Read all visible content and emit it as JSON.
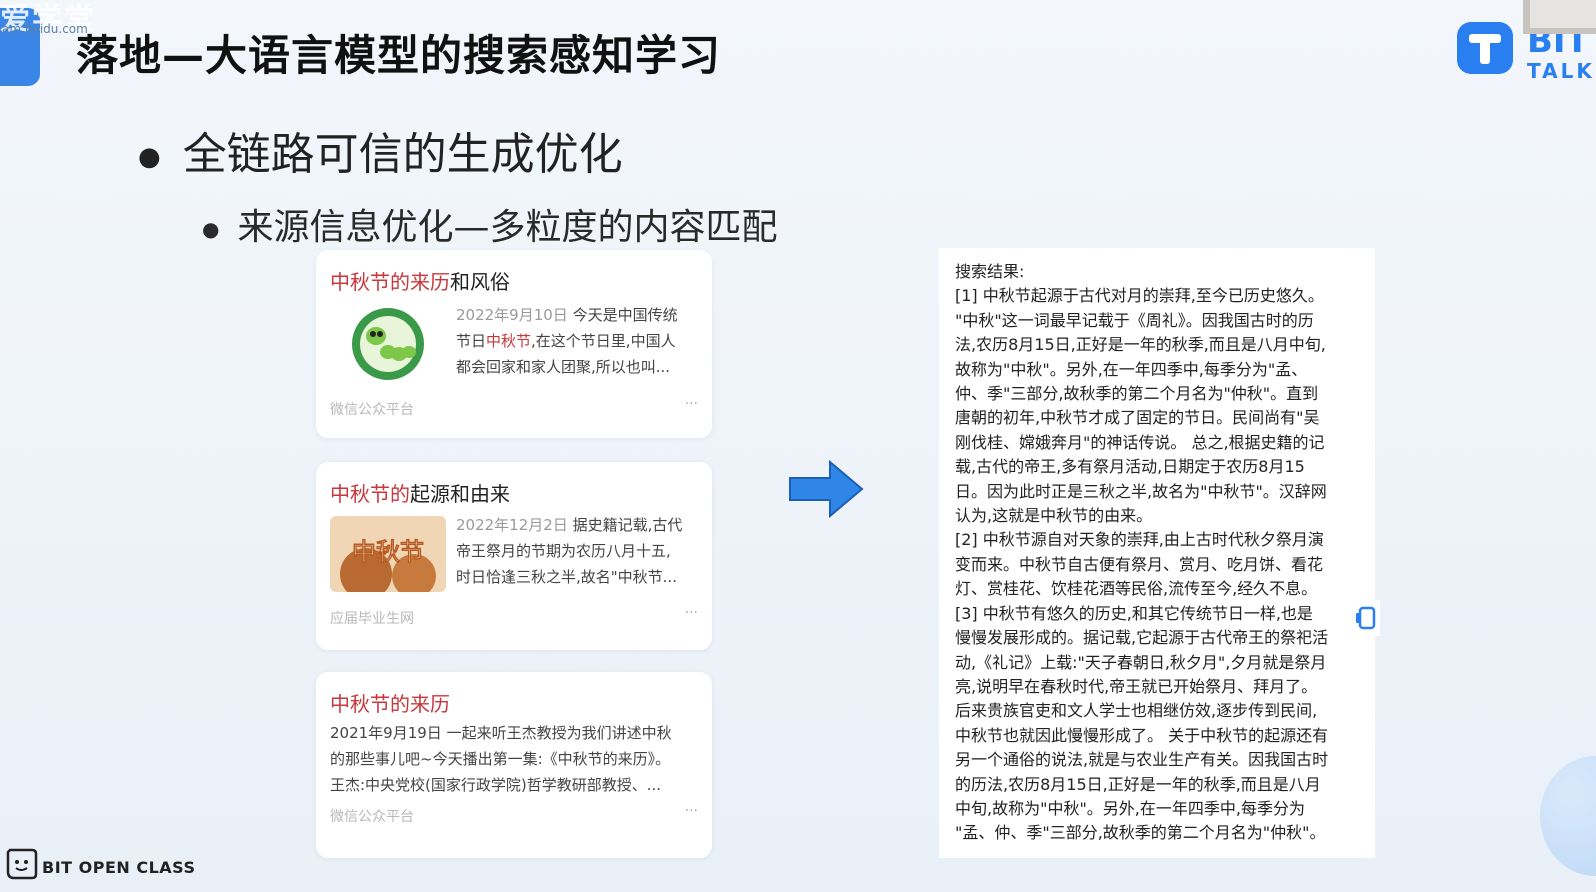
{
  "watermark": {
    "brand": "爱学堂",
    "url": "am.baidu.com"
  },
  "slide": {
    "title": "落地—大语言模型的搜索感知学习",
    "bullet1": "全链路可信的生成优化",
    "bullet2": "来源信息优化—多粒度的内容匹配"
  },
  "logos": {
    "tal_line1": "BIT",
    "tal_line2": "TALK",
    "bottom": "BIT OPEN CLASS"
  },
  "cards": [
    {
      "title_hl": "中秋节的来历",
      "title_rest": "和风俗",
      "date": "2022年9月10日",
      "line1": " 今天是中国传统",
      "line2_pre": "节日",
      "line2_hl": "中秋节",
      "line2_post": ",在这个节日里,中国人",
      "line3": "都会回家和家人团聚,所以也叫...",
      "source": "微信公众平台",
      "more": "···"
    },
    {
      "title_hl": "中秋节的",
      "title_rest": "起源和由来",
      "date": "2022年12月2日",
      "line1": " 据史籍记载,古代",
      "line2": "帝王祭月的节期为农历八月十五,",
      "line3": "时日恰逢三秋之半,故名\"中秋节...",
      "thumb_text": "中秋节",
      "source": "应届毕业生网",
      "more": "···"
    },
    {
      "title_hl": "中秋节的来历",
      "title_rest": "",
      "date": "2021年9月19日",
      "line1": " 一起来听王杰教授为我们讲述中秋",
      "line2_pre": "的那些事儿吧~今天播出第一集:《",
      "line2_hl": "中秋节的来历",
      "line2_post": "》。",
      "line3": "王杰:中央党校(国家行政学院)哲学教研部教授、...",
      "source": "微信公众平台",
      "more": "···"
    }
  ],
  "result_panel": {
    "text": "搜索结果:\n[1] 中秋节起源于古代对月的崇拜,至今已历史悠久。\n\"中秋\"这一词最早记载于《周礼》。因我国古时的历\n法,农历8月15日,正好是一年的秋季,而且是八月中旬,\n故称为\"中秋\"。另外,在一年四季中,每季分为\"孟、\n仲、季\"三部分,故秋季的第二个月名为\"仲秋\"。直到\n唐朝的初年,中秋节才成了固定的节日。民间尚有\"吴\n刚伐桂、嫦娥奔月\"的神话传说。 总之,根据史籍的记\n载,古代的帝王,多有祭月活动,日期定于农历8月15\n日。因为此时正是三秋之半,故名为\"中秋节\"。汉辞网\n认为,这就是中秋节的由来。\n[2] 中秋节源自对天象的崇拜,由上古时代秋夕祭月演\n变而来。中秋节自古便有祭月、赏月、吃月饼、看花\n灯、赏桂花、饮桂花酒等民俗,流传至今,经久不息。\n[3] 中秋节有悠久的历史,和其它传统节日一样,也是\n慢慢发展形成的。据记载,它起源于古代帝王的祭祀活\n动,《礼记》上载:\"天子春朝日,秋夕月\",夕月就是祭月\n亮,说明早在春秋时代,帝王就已开始祭月、拜月了。\n后来贵族官吏和文人学士也相继仿效,逐步传到民间,\n中秋节也就因此慢慢形成了。 关于中秋节的起源还有\n另一个通俗的说法,就是与农业生产有关。因我国古时\n的历法,农历8月15日,正好是一年的秋季,而且是八月\n中旬,故称为\"中秋\"。另外,在一年四季中,每季分为\n\"孟、仲、季\"三部分,故秋季的第二个月名为\"仲秋\"。"
  },
  "icons": [
    "arrow-right-icon",
    "tal-logo-icon",
    "bit-open-class-icon",
    "side-action-icon"
  ],
  "colors": {
    "highlight": "#c8373b",
    "accent": "#2a7ff0",
    "arrow": "#2f86e6"
  }
}
